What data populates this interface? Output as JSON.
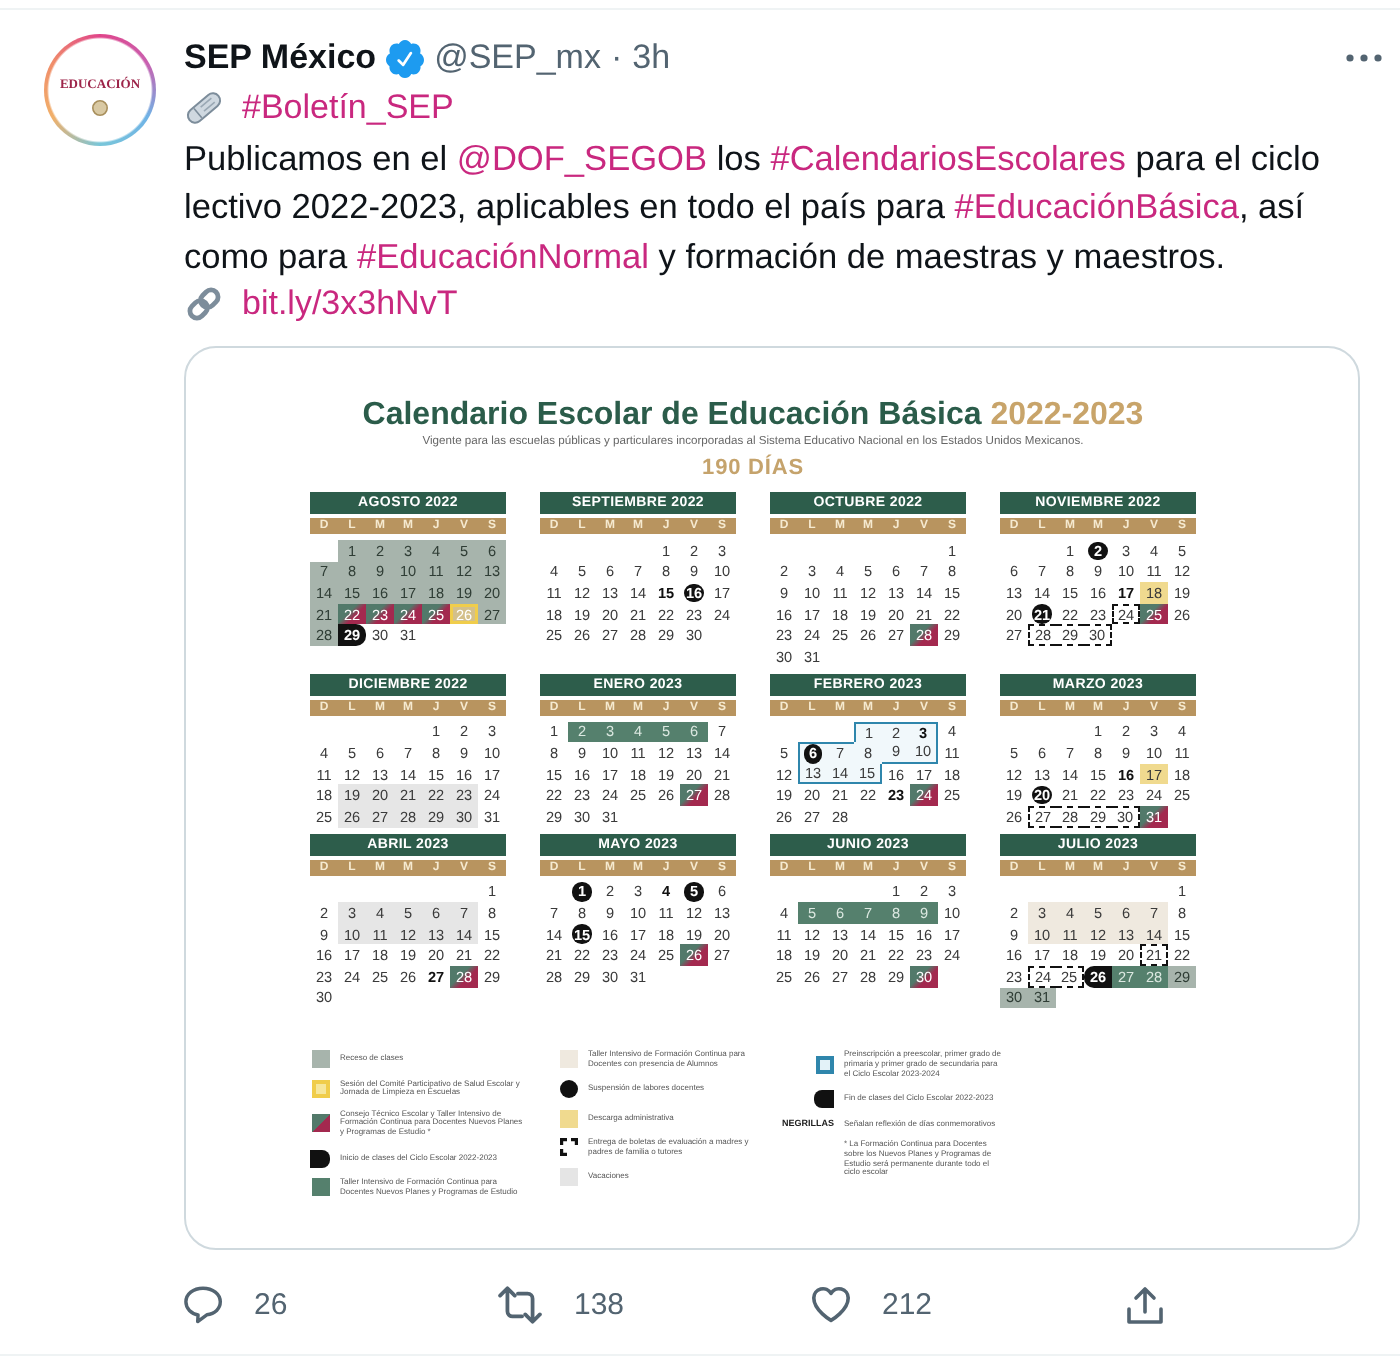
{
  "tweet": {
    "author": {
      "name": "SEP México",
      "verified": true,
      "handle": "@SEP_mx",
      "separator": "·",
      "time": "3h",
      "avatar_text": "EDUCACIÓN"
    },
    "tag": "#Boletín_SEP",
    "body": [
      [
        {
          "kind": "text",
          "text": "Publicamos en el "
        },
        {
          "kind": "link",
          "text": "@DOF_SEGOB"
        },
        {
          "kind": "text",
          "text": " los "
        },
        {
          "kind": "link",
          "text": "#CalendariosEscolares"
        },
        {
          "kind": "text",
          "text": " para el ciclo"
        }
      ],
      [
        {
          "kind": "text",
          "text": "lectivo 2022-2023, aplicables en todo el país para "
        },
        {
          "kind": "link",
          "text": "#EducaciónBásica"
        },
        {
          "kind": "text",
          "text": ", así"
        }
      ],
      [
        {
          "kind": "text",
          "text": "como para "
        },
        {
          "kind": "link",
          "text": "#EducaciónNormal"
        },
        {
          "kind": "text",
          "text": " y formación de maestras y maestros."
        }
      ]
    ],
    "url": "bit.ly/3x3hNvT"
  },
  "calendar": {
    "title": "Calendario Escolar de Educación Básica",
    "year": "2022-2023",
    "subtitle": "Vigente para las escuelas públicas y particulares incorporadas al Sistema Educativo Nacional en los Estados Unidos Mexicanos.",
    "days_total": "190 DÍAS",
    "months": [
      {
        "name": "AGOSTO 2022",
        "weekdays": [
          "D",
          "L",
          "M",
          "M",
          "J",
          "V",
          "S"
        ],
        "weeks": [
          [
            {
              "d": "1",
              "kind": "receso"
            },
            {
              "d": "2",
              "kind": "receso"
            },
            {
              "d": "3",
              "kind": "receso"
            },
            {
              "d": "4",
              "kind": "receso"
            },
            {
              "d": "5",
              "kind": "receso"
            },
            {
              "d": "6",
              "kind": "receso"
            }
          ],
          [
            {
              "d": "7",
              "kind": "receso"
            },
            {
              "d": "8",
              "kind": "receso"
            },
            {
              "d": "9",
              "kind": "receso"
            },
            {
              "d": "10",
              "kind": "receso"
            },
            {
              "d": "11",
              "kind": "receso"
            },
            {
              "d": "12",
              "kind": "receso"
            },
            {
              "d": "13",
              "kind": "receso"
            }
          ],
          [
            {
              "d": "14",
              "kind": "receso"
            },
            {
              "d": "15",
              "kind": "receso"
            },
            {
              "d": "16",
              "kind": "receso"
            },
            {
              "d": "17",
              "kind": "receso"
            },
            {
              "d": "18",
              "kind": "receso"
            },
            {
              "d": "19",
              "kind": "receso"
            },
            {
              "d": "20",
              "kind": "receso"
            }
          ],
          [
            {
              "d": "21",
              "kind": "receso"
            },
            {
              "d": "22",
              "kind": "cte"
            },
            {
              "d": "23",
              "kind": "cte"
            },
            {
              "d": "24",
              "kind": "cte"
            },
            {
              "d": "25",
              "kind": "cte"
            },
            {
              "d": "26",
              "kind": "comite"
            },
            {
              "d": "27",
              "kind": "receso"
            }
          ],
          [
            {
              "d": "28",
              "kind": "receso"
            },
            {
              "d": "29",
              "kind": "inicio"
            },
            "30",
            "31"
          ]
        ]
      },
      {
        "name": "SEPTIEMBRE 2022",
        "weekdays": [
          "D",
          "L",
          "M",
          "M",
          "J",
          "V",
          "S"
        ],
        "weeks": [
          [
            "1",
            "2",
            "3"
          ],
          [
            "4",
            "5",
            "6",
            "7",
            "8",
            "9",
            "10"
          ],
          [
            "11",
            "12",
            "13",
            "14",
            {
              "d": "15",
              "bold": true
            },
            {
              "d": "16",
              "kind": "suspension"
            },
            "17"
          ],
          [
            "18",
            "19",
            "20",
            "21",
            "22",
            "23",
            "24"
          ],
          [
            "25",
            "26",
            "27",
            "28",
            "29",
            "30"
          ]
        ]
      },
      {
        "name": "OCTUBRE 2022",
        "weekdays": [
          "D",
          "L",
          "M",
          "M",
          "J",
          "V",
          "S"
        ],
        "weeks": [
          [
            "1"
          ],
          [
            "2",
            "3",
            "4",
            "5",
            "6",
            "7",
            "8"
          ],
          [
            "9",
            "10",
            "11",
            "12",
            "13",
            "14",
            "15"
          ],
          [
            "16",
            "17",
            "18",
            "19",
            "20",
            "21",
            "22"
          ],
          [
            "23",
            "24",
            "25",
            "26",
            "27",
            {
              "d": "28",
              "kind": "cte"
            },
            "29"
          ],
          [
            "30",
            "31"
          ]
        ]
      },
      {
        "name": "NOVIEMBRE 2022",
        "weekdays": [
          "D",
          "L",
          "M",
          "M",
          "J",
          "V",
          "S"
        ],
        "weeks": [
          [
            "1",
            {
              "d": "2",
              "kind": "suspension"
            },
            "3",
            "4",
            "5"
          ],
          [
            "6",
            "7",
            "8",
            "9",
            "10",
            "11",
            "12"
          ],
          [
            "13",
            "14",
            "15",
            "16",
            {
              "d": "17",
              "bold": true
            },
            {
              "d": "18",
              "kind": "descarga"
            },
            "19"
          ],
          [
            "20",
            {
              "d": "21",
              "kind": "suspension"
            },
            "22",
            "23",
            {
              "d": "24",
              "kind": "boletas"
            },
            {
              "d": "25",
              "kind": "cte"
            },
            "26"
          ],
          [
            "27",
            {
              "d": "28",
              "kind": "boletas"
            },
            {
              "d": "29",
              "kind": "boletas"
            },
            {
              "d": "30",
              "kind": "boletas"
            }
          ]
        ]
      },
      {
        "name": "DICIEMBRE 2022",
        "weekdays": [
          "D",
          "L",
          "M",
          "M",
          "J",
          "V",
          "S"
        ],
        "weeks": [
          [
            "1",
            "2",
            "3"
          ],
          [
            "4",
            "5",
            "6",
            "7",
            "8",
            "9",
            "10"
          ],
          [
            "11",
            "12",
            "13",
            "14",
            "15",
            "16",
            "17"
          ],
          [
            "18",
            {
              "d": "19",
              "kind": "vacaciones"
            },
            {
              "d": "20",
              "kind": "vacaciones"
            },
            {
              "d": "21",
              "kind": "vacaciones"
            },
            {
              "d": "22",
              "kind": "vacaciones"
            },
            {
              "d": "23",
              "kind": "vacaciones"
            },
            "24"
          ],
          [
            "25",
            {
              "d": "26",
              "kind": "vacaciones"
            },
            {
              "d": "27",
              "kind": "vacaciones"
            },
            {
              "d": "28",
              "kind": "vacaciones"
            },
            {
              "d": "29",
              "kind": "vacaciones"
            },
            {
              "d": "30",
              "kind": "vacaciones"
            },
            "31"
          ]
        ]
      },
      {
        "name": "ENERO 2023",
        "weekdays": [
          "D",
          "L",
          "M",
          "M",
          "J",
          "V",
          "S"
        ],
        "weeks": [
          [
            "1",
            {
              "d": "2",
              "kind": "taller"
            },
            {
              "d": "3",
              "kind": "taller"
            },
            {
              "d": "4",
              "kind": "taller"
            },
            {
              "d": "5",
              "kind": "taller"
            },
            {
              "d": "6",
              "kind": "taller"
            },
            "7"
          ],
          [
            "8",
            "9",
            "10",
            "11",
            "12",
            "13",
            "14"
          ],
          [
            "15",
            "16",
            "17",
            "18",
            "19",
            "20",
            "21"
          ],
          [
            "22",
            "23",
            "24",
            "25",
            "26",
            {
              "d": "27",
              "kind": "cte"
            },
            "28"
          ],
          [
            "29",
            "30",
            "31"
          ]
        ]
      },
      {
        "name": "FEBRERO 2023",
        "weekdays": [
          "D",
          "L",
          "M",
          "M",
          "J",
          "V",
          "S"
        ],
        "weeks": [
          [
            {
              "d": "1",
              "outlined": true
            },
            {
              "d": "2",
              "outlined": true
            },
            {
              "d": "3",
              "bold": true,
              "outlined": true
            },
            "4"
          ],
          [
            "5",
            {
              "d": "6",
              "kind": "suspension",
              "outlined": true
            },
            {
              "d": "7",
              "outlined": true
            },
            {
              "d": "8",
              "outlined": true
            },
            {
              "d": "9",
              "outlined": true
            },
            {
              "d": "10",
              "outlined": true
            },
            "11"
          ],
          [
            "12",
            {
              "d": "13",
              "outlined": true
            },
            {
              "d": "14",
              "outlined": true
            },
            {
              "d": "15",
              "outlined": true
            },
            "16",
            "17",
            "18"
          ],
          [
            "19",
            "20",
            "21",
            "22",
            {
              "d": "23",
              "bold": true
            },
            {
              "d": "24",
              "kind": "cte"
            },
            "25"
          ],
          [
            "26",
            "27",
            "28"
          ]
        ]
      },
      {
        "name": "MARZO 2023",
        "weekdays": [
          "D",
          "L",
          "M",
          "M",
          "J",
          "V",
          "S"
        ],
        "weeks": [
          [
            "1",
            "2",
            "3",
            "4"
          ],
          [
            "5",
            "6",
            "7",
            "8",
            "9",
            "10",
            "11"
          ],
          [
            "12",
            "13",
            "14",
            "15",
            {
              "d": "16",
              "bold": true
            },
            {
              "d": "17",
              "kind": "descarga"
            },
            "18"
          ],
          [
            "19",
            {
              "d": "20",
              "kind": "suspension"
            },
            "21",
            "22",
            "23",
            "24",
            "25"
          ],
          [
            "26",
            {
              "d": "27",
              "kind": "boletas"
            },
            {
              "d": "28",
              "kind": "boletas"
            },
            {
              "d": "29",
              "kind": "boletas"
            },
            {
              "d": "30",
              "kind": "boletas"
            },
            {
              "d": "31",
              "kind": "cte"
            }
          ]
        ]
      },
      {
        "name": "ABRIL 2023",
        "weekdays": [
          "D",
          "L",
          "M",
          "M",
          "J",
          "V",
          "S"
        ],
        "weeks": [
          [
            "1"
          ],
          [
            "2",
            {
              "d": "3",
              "kind": "vacaciones"
            },
            {
              "d": "4",
              "kind": "vacaciones"
            },
            {
              "d": "5",
              "kind": "vacaciones"
            },
            {
              "d": "6",
              "kind": "vacaciones"
            },
            {
              "d": "7",
              "kind": "vacaciones"
            },
            "8"
          ],
          [
            "9",
            {
              "d": "10",
              "kind": "vacaciones"
            },
            {
              "d": "11",
              "kind": "vacaciones"
            },
            {
              "d": "12",
              "kind": "vacaciones"
            },
            {
              "d": "13",
              "kind": "vacaciones"
            },
            {
              "d": "14",
              "kind": "vacaciones"
            },
            "15"
          ],
          [
            "16",
            "17",
            "18",
            "19",
            "20",
            "21",
            "22"
          ],
          [
            "23",
            "24",
            "25",
            "26",
            {
              "d": "27",
              "bold": true
            },
            {
              "d": "28",
              "kind": "cte"
            },
            "29"
          ],
          [
            "30"
          ]
        ]
      },
      {
        "name": "MAYO 2023",
        "weekdays": [
          "D",
          "L",
          "M",
          "M",
          "J",
          "V",
          "S"
        ],
        "weeks": [
          [
            {
              "d": "1",
              "kind": "suspension"
            },
            "2",
            "3",
            {
              "d": "4",
              "bold": true
            },
            {
              "d": "5",
              "kind": "suspension"
            },
            "6"
          ],
          [
            "7",
            "8",
            "9",
            "10",
            "11",
            "12",
            "13"
          ],
          [
            "14",
            {
              "d": "15",
              "kind": "suspension"
            },
            "16",
            "17",
            "18",
            "19",
            "20"
          ],
          [
            "21",
            "22",
            "23",
            "24",
            "25",
            {
              "d": "26",
              "kind": "cte"
            },
            "27"
          ],
          [
            "28",
            "29",
            "30",
            "31"
          ]
        ]
      },
      {
        "name": "JUNIO 2023",
        "weekdays": [
          "D",
          "L",
          "M",
          "M",
          "J",
          "V",
          "S"
        ],
        "weeks": [
          [
            "1",
            "2",
            "3"
          ],
          [
            "4",
            {
              "d": "5",
              "kind": "taller"
            },
            {
              "d": "6",
              "kind": "taller"
            },
            {
              "d": "7",
              "kind": "taller"
            },
            {
              "d": "8",
              "kind": "taller"
            },
            {
              "d": "9",
              "kind": "taller"
            },
            "10"
          ],
          [
            "11",
            "12",
            "13",
            "14",
            "15",
            "16",
            "17"
          ],
          [
            "18",
            "19",
            "20",
            "21",
            "22",
            "23",
            "24"
          ],
          [
            "25",
            "26",
            "27",
            "28",
            "29",
            {
              "d": "30",
              "kind": "cte"
            }
          ]
        ]
      },
      {
        "name": "JULIO 2023",
        "weekdays": [
          "D",
          "L",
          "M",
          "M",
          "J",
          "V",
          "S"
        ],
        "weeks": [
          [
            "1"
          ],
          [
            "2",
            {
              "d": "3",
              "kind": "alumnos"
            },
            {
              "d": "4",
              "kind": "alumnos"
            },
            {
              "d": "5",
              "kind": "alumnos"
            },
            {
              "d": "6",
              "kind": "alumnos"
            },
            {
              "d": "7",
              "kind": "alumnos"
            },
            "8"
          ],
          [
            "9",
            {
              "d": "10",
              "kind": "alumnos"
            },
            {
              "d": "11",
              "kind": "alumnos"
            },
            {
              "d": "12",
              "kind": "alumnos"
            },
            {
              "d": "13",
              "kind": "alumnos"
            },
            {
              "d": "14",
              "kind": "alumnos"
            },
            "15"
          ],
          [
            "16",
            "17",
            "18",
            "19",
            "20",
            {
              "d": "21",
              "kind": "boletas"
            },
            "22"
          ],
          [
            "23",
            {
              "d": "24",
              "kind": "boletas"
            },
            {
              "d": "25",
              "kind": "boletas"
            },
            {
              "d": "26",
              "kind": "fin"
            },
            {
              "d": "27",
              "kind": "taller"
            },
            {
              "d": "28",
              "kind": "taller"
            },
            {
              "d": "29",
              "kind": "receso"
            }
          ],
          [
            {
              "d": "30",
              "kind": "receso"
            },
            {
              "d": "31",
              "kind": "receso"
            }
          ]
        ]
      }
    ],
    "legend": [
      [
        {
          "kind": "receso",
          "text": "Receso de clases"
        },
        {
          "kind": "comite",
          "text": "Sesión del Comité Participativo de Salud Escolar y Jornada de Limpieza en Escuelas"
        },
        {
          "kind": "cte",
          "text": "Consejo Técnico Escolar y Taller Intensivo de Formación Continua para Docentes Nuevos Planes y Programas de Estudio *"
        },
        {
          "kind": "inicio",
          "text": "Inicio de clases del Ciclo Escolar 2022-2023"
        },
        {
          "kind": "taller",
          "text": "Taller Intensivo de Formación Continua para Docentes Nuevos Planes y Programas de Estudio"
        }
      ],
      [
        {
          "kind": "alumnos",
          "text": "Taller Intensivo de Formación Continua para Docentes con presencia de Alumnos"
        },
        {
          "kind": "suspension",
          "text": "Suspensión de labores docentes"
        },
        {
          "kind": "descarga",
          "text": "Descarga administrativa"
        },
        {
          "kind": "boletas",
          "text": "Entrega de boletas de evaluación a madres y padres de familia o tutores"
        },
        {
          "kind": "vacaciones",
          "text": "Vacaciones"
        }
      ],
      [
        {
          "kind": "preinscripcion",
          "text": "Preinscripción a preescolar, primer grado de primaria y primer grado de secundaria para el Ciclo Escolar 2023-2024"
        },
        {
          "kind": "fin",
          "text": "Fin de clases del Ciclo Escolar 2022-2023"
        },
        {
          "kind": "negrillas",
          "sample": "NEGRILLAS",
          "text": "Señalan reflexión de días conmemorativos"
        },
        {
          "kind": "note",
          "text": "* La Formación Continua para Docentes sobre los Nuevos Planes y Programas de Estudio será permanente durante todo el ciclo escolar"
        }
      ]
    ]
  },
  "actions": [
    {
      "kind": "reply",
      "count": "26"
    },
    {
      "kind": "retweet",
      "count": "138"
    },
    {
      "kind": "like",
      "count": "212"
    },
    {
      "kind": "share"
    }
  ]
}
